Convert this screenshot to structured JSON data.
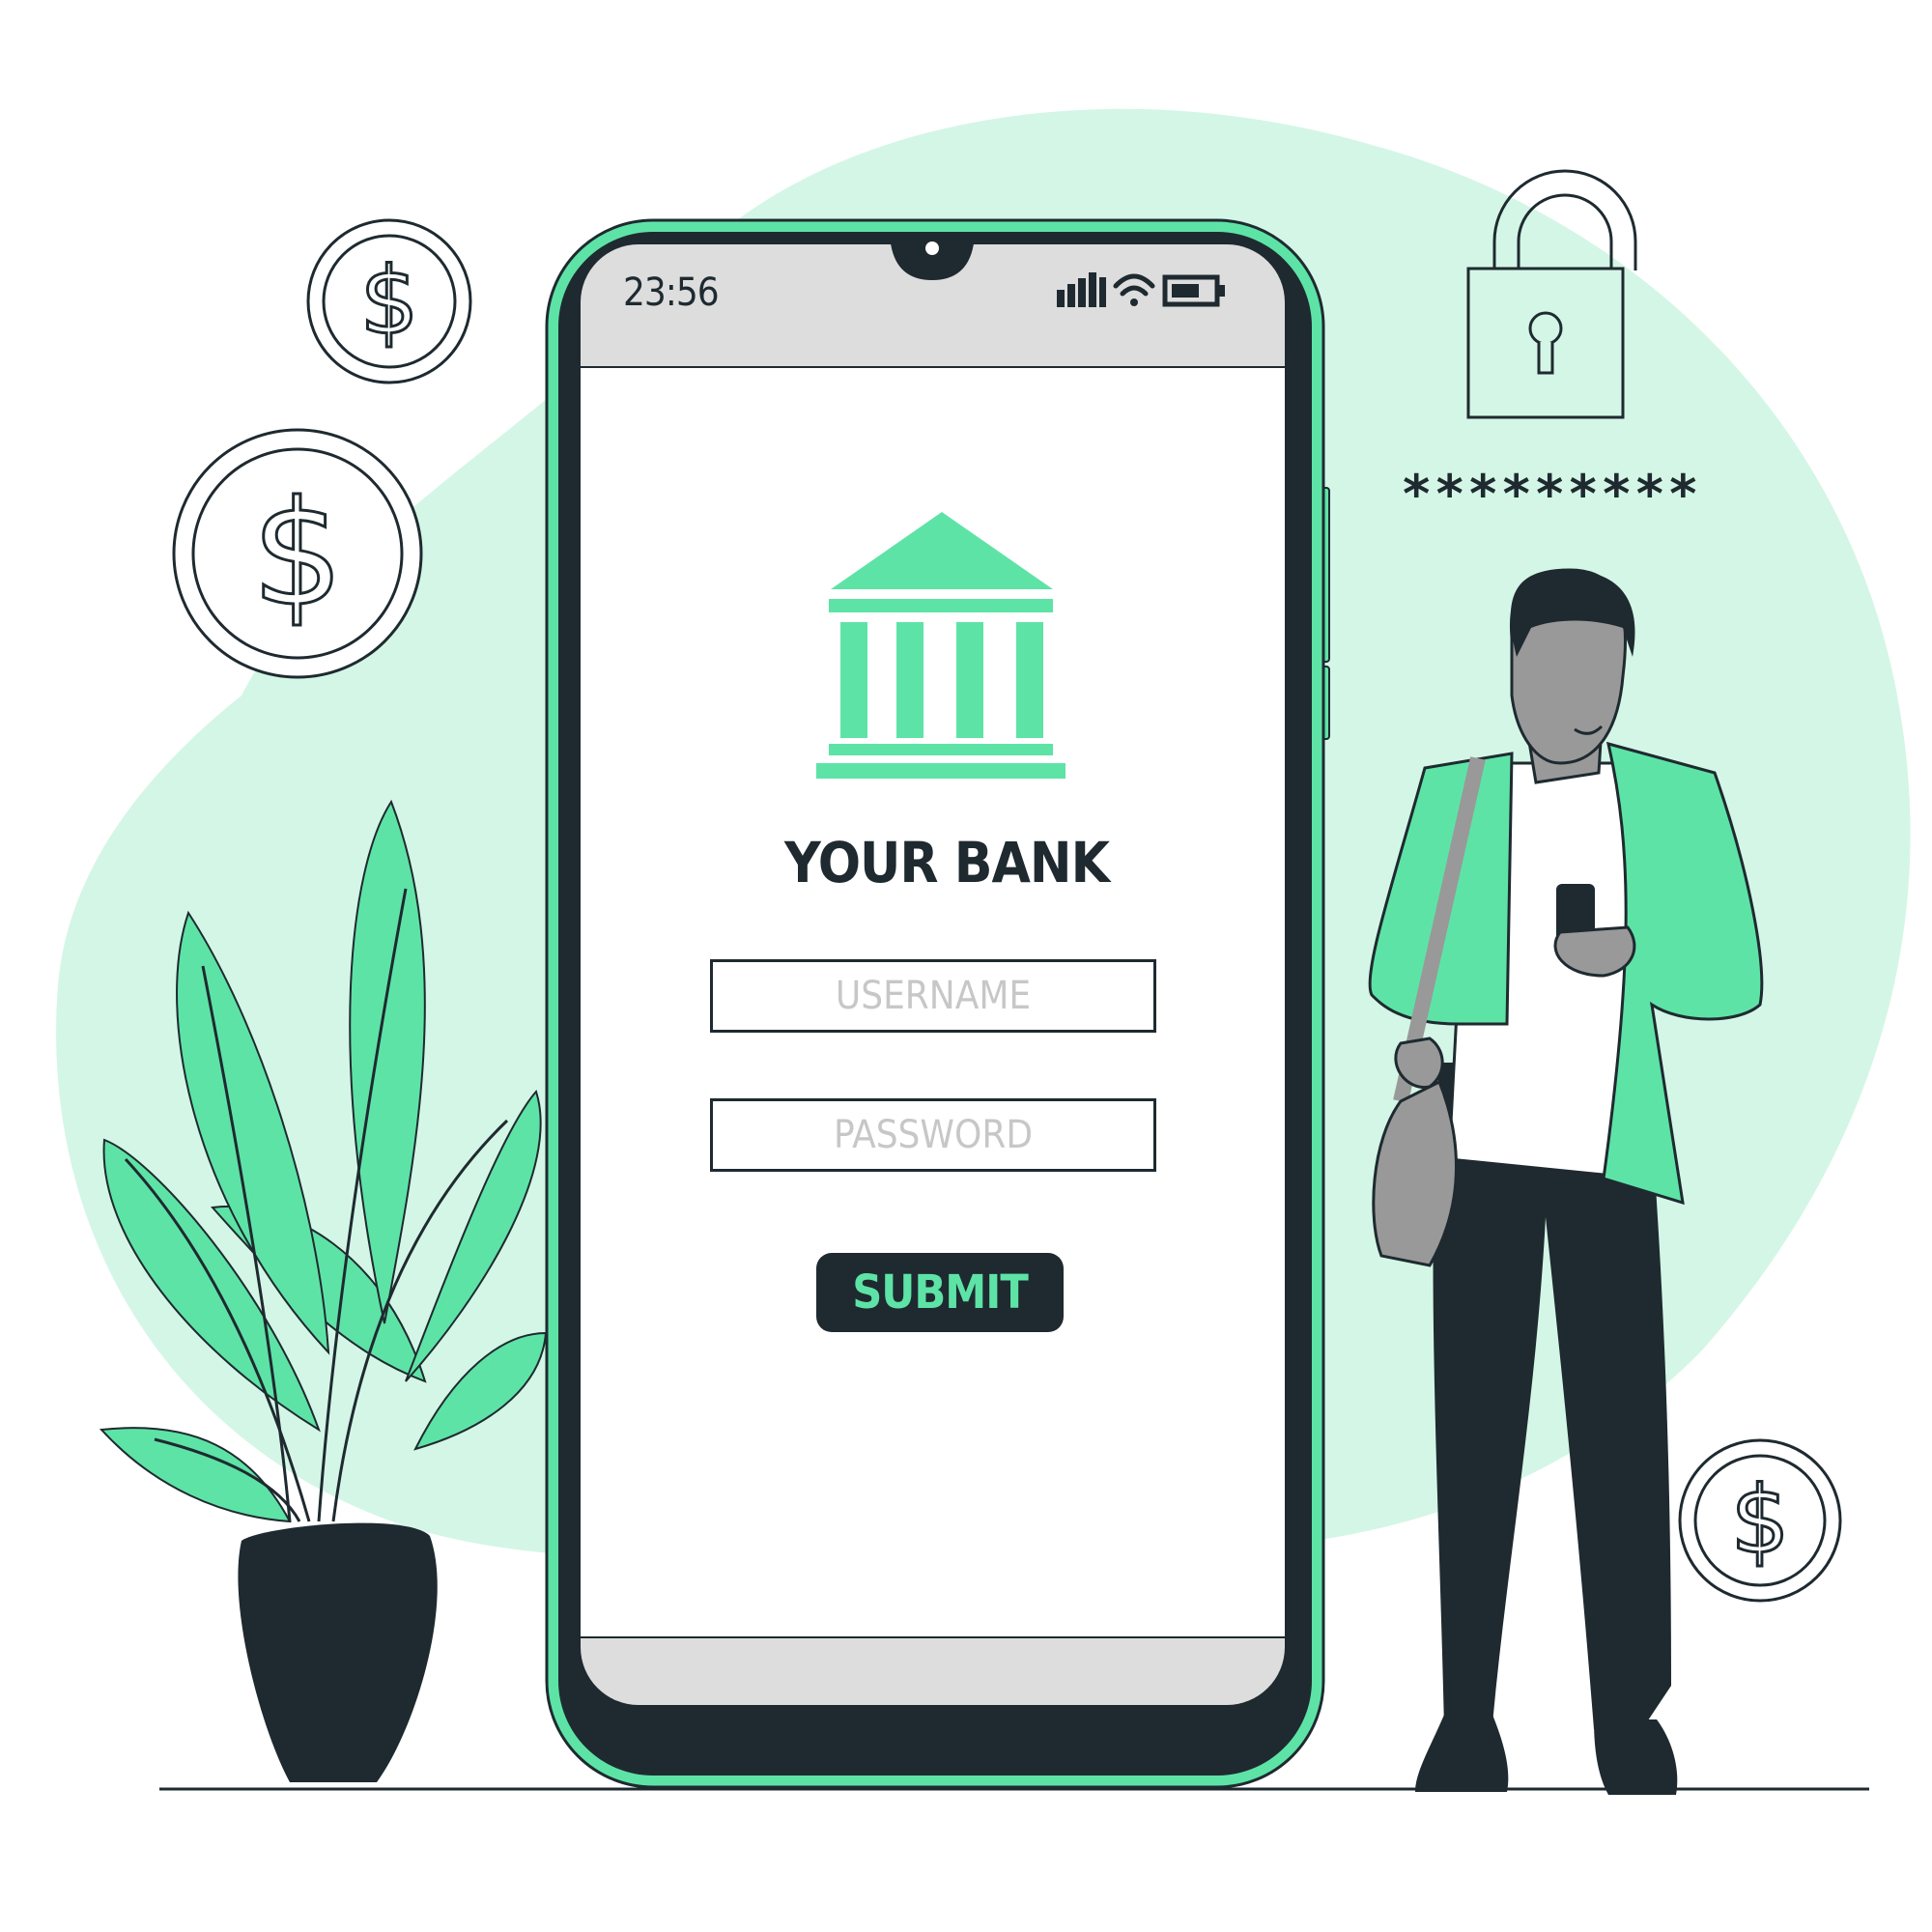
{
  "phone": {
    "status_bar": {
      "time": "23:56",
      "icons": [
        "signal-icon",
        "wifi-icon",
        "battery-icon"
      ]
    },
    "app": {
      "logo_icon": "bank-building-icon",
      "title": "YOUR BANK",
      "username_placeholder": "USERNAME",
      "password_placeholder": "PASSWORD",
      "submit_label": "SUBMIT"
    }
  },
  "decor": {
    "password_mask": "*********",
    "icons": [
      "dollar-coin-icon",
      "padlock-icon",
      "plant-icon",
      "person-illustration"
    ]
  },
  "colors": {
    "accent": "#5ee3a6",
    "dark": "#1e2a30",
    "blob": "#d4f6e6",
    "screen_bar": "#dddddd",
    "placeholder": "#c7c7c7"
  }
}
